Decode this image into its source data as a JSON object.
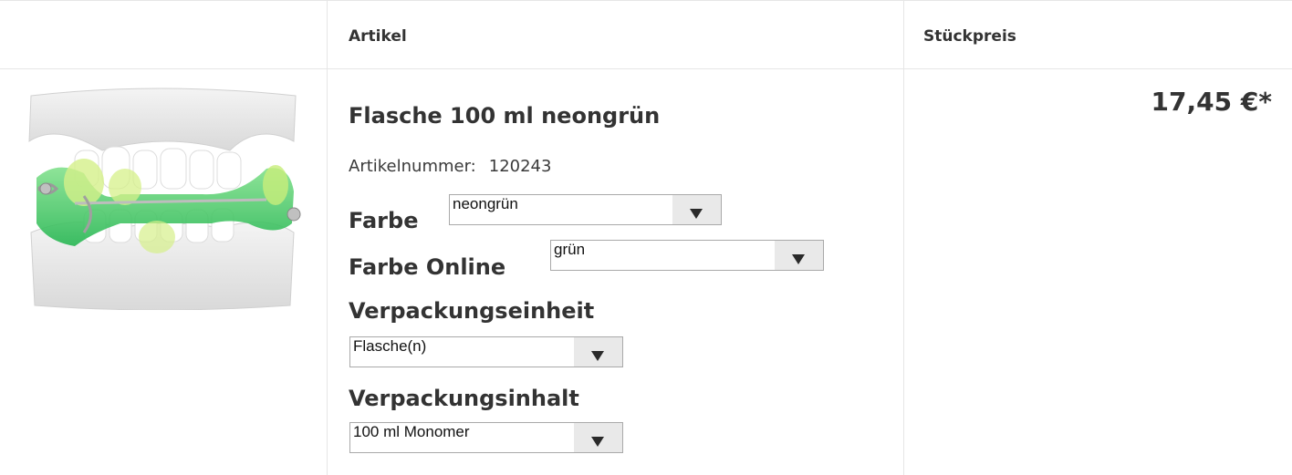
{
  "columns": {
    "artikel": "Artikel",
    "preis": "Stückpreis"
  },
  "product": {
    "image_alt": "Dental model with green orthodontic appliance",
    "title": "Flasche 100 ml neongrün",
    "artnr_label": "Artikelnummer:",
    "artnr_value": "120243",
    "price": "17,45 €*"
  },
  "options": {
    "farbe": {
      "label": "Farbe",
      "value": "neongrün"
    },
    "farbe_online": {
      "label": "Farbe Online",
      "value": "grün"
    },
    "verpackungseinheit": {
      "label": "Verpackungseinheit",
      "value": "Flasche(n)"
    },
    "verpackungsinhalt": {
      "label": "Verpackungsinhalt",
      "value": "100 ml Monomer"
    }
  },
  "colors": {
    "appliance_green": "#3ccf68",
    "border": "#e6e6e6"
  },
  "icons": {
    "dropdown": "triangle-down-icon"
  }
}
